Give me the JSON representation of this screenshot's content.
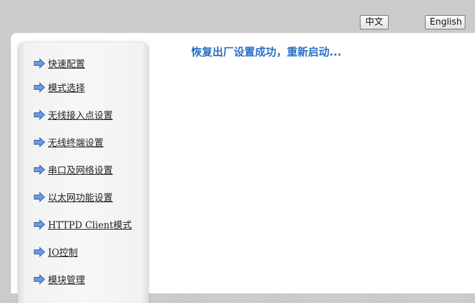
{
  "header": {
    "lang_zh_label": "中文",
    "lang_en_label": "English"
  },
  "sidebar": {
    "items": [
      {
        "label": "快速配置"
      },
      {
        "label": "模式选择"
      },
      {
        "label": "无线接入点设置"
      },
      {
        "label": "无线终端设置"
      },
      {
        "label": "串口及网络设置"
      },
      {
        "label": "以太网功能设置"
      },
      {
        "label": "HTTPD Client模式"
      },
      {
        "label": "IO控制"
      },
      {
        "label": "模块管理"
      }
    ],
    "icon": "arrow-right-icon"
  },
  "main": {
    "status_message": "恢复出厂设置成功，重新启动..."
  },
  "colors": {
    "background": "#c8c8c8",
    "panel": "#ffffff",
    "status_text": "#2a6fc2",
    "arrow_fill": "#6a9be0",
    "arrow_stroke": "#2f5fa6"
  }
}
